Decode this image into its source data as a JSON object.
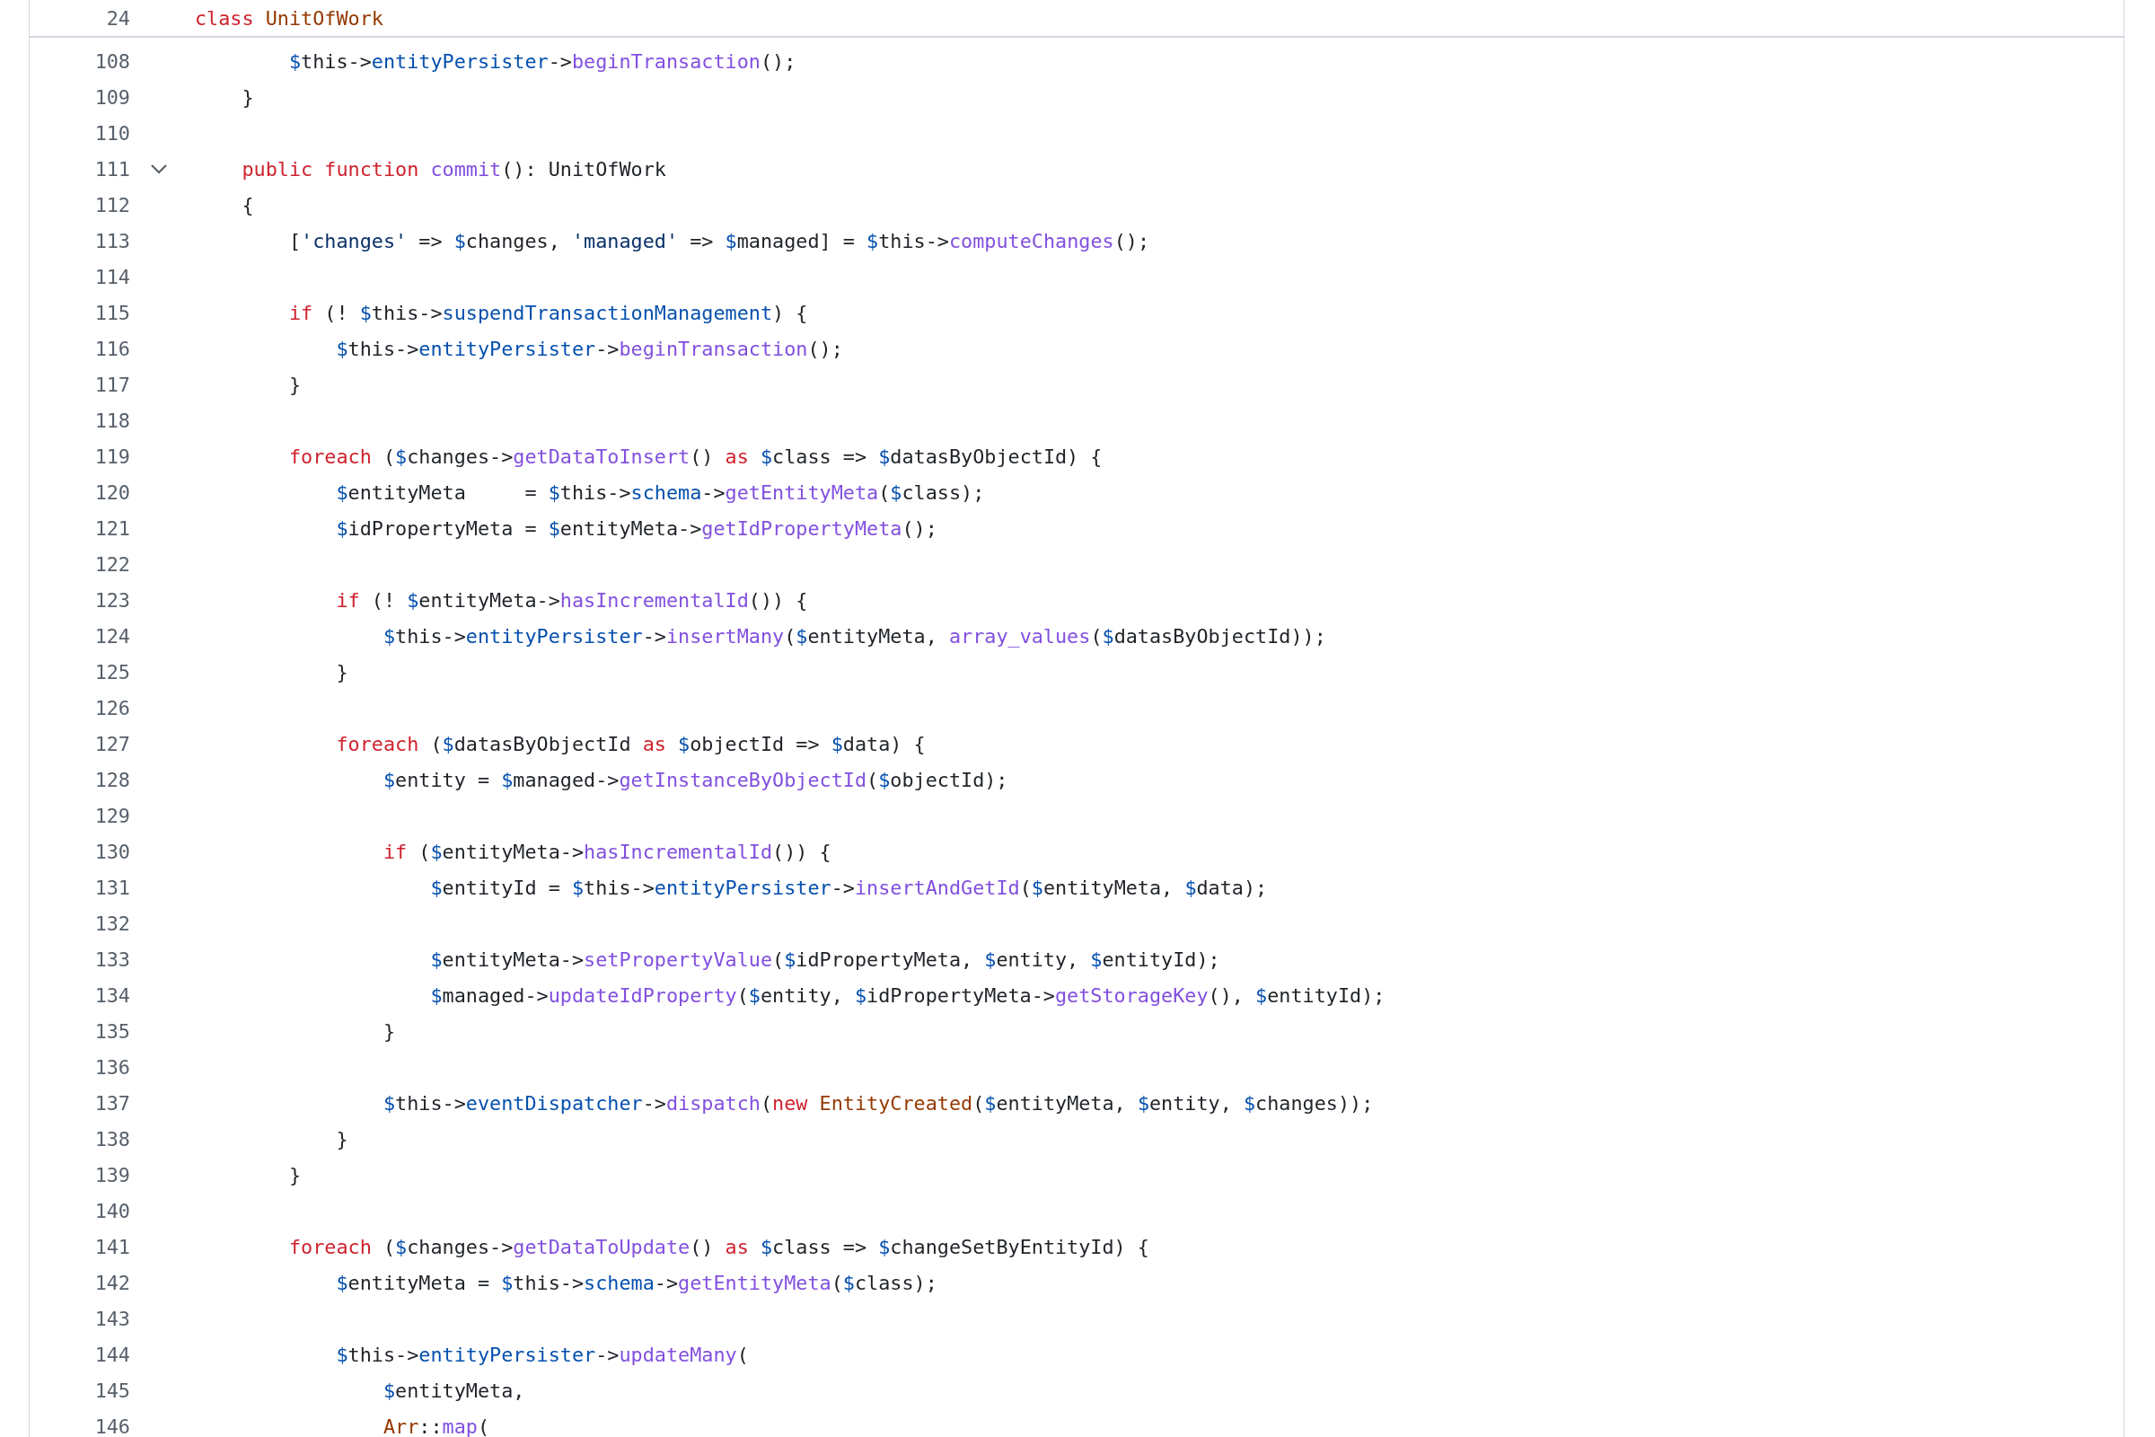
{
  "sticky_header": {
    "number": "24",
    "tokens": [
      {
        "kind": "keyword",
        "text": "class "
      },
      {
        "kind": "type",
        "text": "UnitOfWork"
      }
    ]
  },
  "lines": [
    {
      "children": [
        {
          "number": "108",
          "tokens": [
            {
              "kind": "sigil",
              "text": "$"
            },
            {
              "kind": "plain",
              "text": "this->"
            },
            {
              "kind": "property",
              "text": "entityPersister"
            },
            {
              "kind": "plain",
              "text": "->"
            },
            {
              "kind": "method",
              "text": "beginTransaction"
            },
            {
              "kind": "plain",
              "text": "();"
            }
          ]
        }
      ]
    },
    {
      "number": "109",
      "tokens": [
        {
          "kind": "plain",
          "text": "}"
        }
      ]
    },
    {
      "number": "110"
    },
    {
      "number": "111",
      "fold_expanded": true,
      "tokens": [
        {
          "kind": "keyword",
          "text": "public function "
        },
        {
          "kind": "method",
          "text": "commit"
        },
        {
          "kind": "plain",
          "text": "(): UnitOfWork"
        }
      ]
    },
    {
      "number": "112",
      "tokens": [
        {
          "kind": "plain",
          "text": "{"
        }
      ],
      "children": [
        {
          "number": "113",
          "tokens": [
            {
              "kind": "plain",
              "text": "["
            },
            {
              "kind": "string",
              "text": "'changes'"
            },
            {
              "kind": "plain",
              "text": " => "
            },
            {
              "kind": "sigil",
              "text": "$"
            },
            {
              "kind": "plain",
              "text": "changes, "
            },
            {
              "kind": "string",
              "text": "'managed'"
            },
            {
              "kind": "plain",
              "text": " => "
            },
            {
              "kind": "sigil",
              "text": "$"
            },
            {
              "kind": "plain",
              "text": "managed] = "
            },
            {
              "kind": "sigil",
              "text": "$"
            },
            {
              "kind": "plain",
              "text": "this->"
            },
            {
              "kind": "method",
              "text": "computeChanges"
            },
            {
              "kind": "plain",
              "text": "();"
            }
          ]
        },
        {
          "number": "114"
        },
        {
          "number": "115",
          "tokens": [
            {
              "kind": "keyword",
              "text": "if"
            },
            {
              "kind": "plain",
              "text": " (! "
            },
            {
              "kind": "sigil",
              "text": "$"
            },
            {
              "kind": "plain",
              "text": "this->"
            },
            {
              "kind": "property",
              "text": "suspendTransactionManagement"
            },
            {
              "kind": "plain",
              "text": ") {"
            }
          ],
          "children": [
            {
              "number": "116",
              "tokens": [
                {
                  "kind": "sigil",
                  "text": "$"
                },
                {
                  "kind": "plain",
                  "text": "this->"
                },
                {
                  "kind": "property",
                  "text": "entityPersister"
                },
                {
                  "kind": "plain",
                  "text": "->"
                },
                {
                  "kind": "method",
                  "text": "beginTransaction"
                },
                {
                  "kind": "plain",
                  "text": "();"
                }
              ]
            }
          ]
        },
        {
          "number": "117",
          "tokens": [
            {
              "kind": "plain",
              "text": "}"
            }
          ]
        },
        {
          "number": "118"
        },
        {
          "number": "119",
          "tokens": [
            {
              "kind": "keyword",
              "text": "foreach"
            },
            {
              "kind": "plain",
              "text": " ("
            },
            {
              "kind": "sigil",
              "text": "$"
            },
            {
              "kind": "plain",
              "text": "changes->"
            },
            {
              "kind": "method",
              "text": "getDataToInsert"
            },
            {
              "kind": "plain",
              "text": "() "
            },
            {
              "kind": "keyword",
              "text": "as "
            },
            {
              "kind": "sigil",
              "text": "$"
            },
            {
              "kind": "plain",
              "text": "class => "
            },
            {
              "kind": "sigil",
              "text": "$"
            },
            {
              "kind": "plain",
              "text": "datasByObjectId) {"
            }
          ],
          "children": [
            {
              "number": "120",
              "tokens": [
                {
                  "kind": "sigil",
                  "text": "$"
                },
                {
                  "kind": "plain",
                  "text": "entityMeta     = "
                },
                {
                  "kind": "sigil",
                  "text": "$"
                },
                {
                  "kind": "plain",
                  "text": "this->"
                },
                {
                  "kind": "property",
                  "text": "schema"
                },
                {
                  "kind": "plain",
                  "text": "->"
                },
                {
                  "kind": "method",
                  "text": "getEntityMeta"
                },
                {
                  "kind": "plain",
                  "text": "("
                },
                {
                  "kind": "sigil",
                  "text": "$"
                },
                {
                  "kind": "plain",
                  "text": "class);"
                }
              ]
            },
            {
              "number": "121",
              "tokens": [
                {
                  "kind": "sigil",
                  "text": "$"
                },
                {
                  "kind": "plain",
                  "text": "idPropertyMeta = "
                },
                {
                  "kind": "sigil",
                  "text": "$"
                },
                {
                  "kind": "plain",
                  "text": "entityMeta->"
                },
                {
                  "kind": "method",
                  "text": "getIdPropertyMeta"
                },
                {
                  "kind": "plain",
                  "text": "();"
                }
              ]
            },
            {
              "number": "122"
            },
            {
              "number": "123",
              "tokens": [
                {
                  "kind": "keyword",
                  "text": "if"
                },
                {
                  "kind": "plain",
                  "text": " (! "
                },
                {
                  "kind": "sigil",
                  "text": "$"
                },
                {
                  "kind": "plain",
                  "text": "entityMeta->"
                },
                {
                  "kind": "method",
                  "text": "hasIncrementalId"
                },
                {
                  "kind": "plain",
                  "text": "()) {"
                }
              ],
              "children": [
                {
                  "number": "124",
                  "tokens": [
                    {
                      "kind": "sigil",
                      "text": "$"
                    },
                    {
                      "kind": "plain",
                      "text": "this->"
                    },
                    {
                      "kind": "property",
                      "text": "entityPersister"
                    },
                    {
                      "kind": "plain",
                      "text": "->"
                    },
                    {
                      "kind": "method",
                      "text": "insertMany"
                    },
                    {
                      "kind": "plain",
                      "text": "("
                    },
                    {
                      "kind": "sigil",
                      "text": "$"
                    },
                    {
                      "kind": "plain",
                      "text": "entityMeta, "
                    },
                    {
                      "kind": "method",
                      "text": "array_values"
                    },
                    {
                      "kind": "plain",
                      "text": "("
                    },
                    {
                      "kind": "sigil",
                      "text": "$"
                    },
                    {
                      "kind": "plain",
                      "text": "datasByObjectId));"
                    }
                  ]
                }
              ]
            },
            {
              "number": "125",
              "tokens": [
                {
                  "kind": "plain",
                  "text": "}"
                }
              ]
            },
            {
              "number": "126"
            },
            {
              "number": "127",
              "tokens": [
                {
                  "kind": "keyword",
                  "text": "foreach"
                },
                {
                  "kind": "plain",
                  "text": " ("
                },
                {
                  "kind": "sigil",
                  "text": "$"
                },
                {
                  "kind": "plain",
                  "text": "datasByObjectId "
                },
                {
                  "kind": "keyword",
                  "text": "as "
                },
                {
                  "kind": "sigil",
                  "text": "$"
                },
                {
                  "kind": "plain",
                  "text": "objectId => "
                },
                {
                  "kind": "sigil",
                  "text": "$"
                },
                {
                  "kind": "plain",
                  "text": "data) {"
                }
              ],
              "children": [
                {
                  "number": "128",
                  "tokens": [
                    {
                      "kind": "sigil",
                      "text": "$"
                    },
                    {
                      "kind": "plain",
                      "text": "entity = "
                    },
                    {
                      "kind": "sigil",
                      "text": "$"
                    },
                    {
                      "kind": "plain",
                      "text": "managed->"
                    },
                    {
                      "kind": "method",
                      "text": "getInstanceByObjectId"
                    },
                    {
                      "kind": "plain",
                      "text": "("
                    },
                    {
                      "kind": "sigil",
                      "text": "$"
                    },
                    {
                      "kind": "plain",
                      "text": "objectId);"
                    }
                  ]
                },
                {
                  "number": "129"
                },
                {
                  "number": "130",
                  "tokens": [
                    {
                      "kind": "keyword",
                      "text": "if"
                    },
                    {
                      "kind": "plain",
                      "text": " ("
                    },
                    {
                      "kind": "sigil",
                      "text": "$"
                    },
                    {
                      "kind": "plain",
                      "text": "entityMeta->"
                    },
                    {
                      "kind": "method",
                      "text": "hasIncrementalId"
                    },
                    {
                      "kind": "plain",
                      "text": "()) {"
                    }
                  ],
                  "children": [
                    {
                      "number": "131",
                      "tokens": [
                        {
                          "kind": "sigil",
                          "text": "$"
                        },
                        {
                          "kind": "plain",
                          "text": "entityId = "
                        },
                        {
                          "kind": "sigil",
                          "text": "$"
                        },
                        {
                          "kind": "plain",
                          "text": "this->"
                        },
                        {
                          "kind": "property",
                          "text": "entityPersister"
                        },
                        {
                          "kind": "plain",
                          "text": "->"
                        },
                        {
                          "kind": "method",
                          "text": "insertAndGetId"
                        },
                        {
                          "kind": "plain",
                          "text": "("
                        },
                        {
                          "kind": "sigil",
                          "text": "$"
                        },
                        {
                          "kind": "plain",
                          "text": "entityMeta, "
                        },
                        {
                          "kind": "sigil",
                          "text": "$"
                        },
                        {
                          "kind": "plain",
                          "text": "data);"
                        }
                      ]
                    },
                    {
                      "number": "132"
                    },
                    {
                      "number": "133",
                      "tokens": [
                        {
                          "kind": "sigil",
                          "text": "$"
                        },
                        {
                          "kind": "plain",
                          "text": "entityMeta->"
                        },
                        {
                          "kind": "method",
                          "text": "setPropertyValue"
                        },
                        {
                          "kind": "plain",
                          "text": "("
                        },
                        {
                          "kind": "sigil",
                          "text": "$"
                        },
                        {
                          "kind": "plain",
                          "text": "idPropertyMeta, "
                        },
                        {
                          "kind": "sigil",
                          "text": "$"
                        },
                        {
                          "kind": "plain",
                          "text": "entity, "
                        },
                        {
                          "kind": "sigil",
                          "text": "$"
                        },
                        {
                          "kind": "plain",
                          "text": "entityId);"
                        }
                      ]
                    },
                    {
                      "number": "134",
                      "tokens": [
                        {
                          "kind": "sigil",
                          "text": "$"
                        },
                        {
                          "kind": "plain",
                          "text": "managed->"
                        },
                        {
                          "kind": "method",
                          "text": "updateIdProperty"
                        },
                        {
                          "kind": "plain",
                          "text": "("
                        },
                        {
                          "kind": "sigil",
                          "text": "$"
                        },
                        {
                          "kind": "plain",
                          "text": "entity, "
                        },
                        {
                          "kind": "sigil",
                          "text": "$"
                        },
                        {
                          "kind": "plain",
                          "text": "idPropertyMeta->"
                        },
                        {
                          "kind": "method",
                          "text": "getStorageKey"
                        },
                        {
                          "kind": "plain",
                          "text": "(), "
                        },
                        {
                          "kind": "sigil",
                          "text": "$"
                        },
                        {
                          "kind": "plain",
                          "text": "entityId);"
                        }
                      ]
                    }
                  ]
                },
                {
                  "number": "135",
                  "tokens": [
                    {
                      "kind": "plain",
                      "text": "}"
                    }
                  ]
                },
                {
                  "number": "136"
                },
                {
                  "number": "137",
                  "tokens": [
                    {
                      "kind": "sigil",
                      "text": "$"
                    },
                    {
                      "kind": "plain",
                      "text": "this->"
                    },
                    {
                      "kind": "property",
                      "text": "eventDispatcher"
                    },
                    {
                      "kind": "plain",
                      "text": "->"
                    },
                    {
                      "kind": "method",
                      "text": "dispatch"
                    },
                    {
                      "kind": "plain",
                      "text": "("
                    },
                    {
                      "kind": "keyword",
                      "text": "new "
                    },
                    {
                      "kind": "type",
                      "text": "EntityCreated"
                    },
                    {
                      "kind": "plain",
                      "text": "("
                    },
                    {
                      "kind": "sigil",
                      "text": "$"
                    },
                    {
                      "kind": "plain",
                      "text": "entityMeta, "
                    },
                    {
                      "kind": "sigil",
                      "text": "$"
                    },
                    {
                      "kind": "plain",
                      "text": "entity, "
                    },
                    {
                      "kind": "sigil",
                      "text": "$"
                    },
                    {
                      "kind": "plain",
                      "text": "changes));"
                    }
                  ]
                }
              ]
            },
            {
              "number": "138",
              "tokens": [
                {
                  "kind": "plain",
                  "text": "}"
                }
              ]
            }
          ]
        },
        {
          "number": "139",
          "tokens": [
            {
              "kind": "plain",
              "text": "}"
            }
          ]
        },
        {
          "number": "140"
        },
        {
          "number": "141",
          "tokens": [
            {
              "kind": "keyword",
              "text": "foreach"
            },
            {
              "kind": "plain",
              "text": " ("
            },
            {
              "kind": "sigil",
              "text": "$"
            },
            {
              "kind": "plain",
              "text": "changes->"
            },
            {
              "kind": "method",
              "text": "getDataToUpdate"
            },
            {
              "kind": "plain",
              "text": "() "
            },
            {
              "kind": "keyword",
              "text": "as "
            },
            {
              "kind": "sigil",
              "text": "$"
            },
            {
              "kind": "plain",
              "text": "class => "
            },
            {
              "kind": "sigil",
              "text": "$"
            },
            {
              "kind": "plain",
              "text": "changeSetByEntityId) {"
            }
          ],
          "children": [
            {
              "number": "142",
              "tokens": [
                {
                  "kind": "sigil",
                  "text": "$"
                },
                {
                  "kind": "plain",
                  "text": "entityMeta = "
                },
                {
                  "kind": "sigil",
                  "text": "$"
                },
                {
                  "kind": "plain",
                  "text": "this->"
                },
                {
                  "kind": "property",
                  "text": "schema"
                },
                {
                  "kind": "plain",
                  "text": "->"
                },
                {
                  "kind": "method",
                  "text": "getEntityMeta"
                },
                {
                  "kind": "plain",
                  "text": "("
                },
                {
                  "kind": "sigil",
                  "text": "$"
                },
                {
                  "kind": "plain",
                  "text": "class);"
                }
              ]
            },
            {
              "number": "143"
            },
            {
              "number": "144",
              "tokens": [
                {
                  "kind": "sigil",
                  "text": "$"
                },
                {
                  "kind": "plain",
                  "text": "this->"
                },
                {
                  "kind": "property",
                  "text": "entityPersister"
                },
                {
                  "kind": "plain",
                  "text": "->"
                },
                {
                  "kind": "method",
                  "text": "updateMany"
                },
                {
                  "kind": "plain",
                  "text": "("
                }
              ],
              "children": [
                {
                  "number": "145",
                  "tokens": [
                    {
                      "kind": "sigil",
                      "text": "$"
                    },
                    {
                      "kind": "plain",
                      "text": "entityMeta,"
                    }
                  ]
                },
                {
                  "number": "146",
                  "tokens": [
                    {
                      "kind": "type",
                      "text": "Arr"
                    },
                    {
                      "kind": "plain",
                      "text": "::"
                    },
                    {
                      "kind": "method",
                      "text": "map"
                    },
                    {
                      "kind": "plain",
                      "text": "("
                    }
                  ]
                }
              ]
            }
          ]
        }
      ]
    }
  ]
}
